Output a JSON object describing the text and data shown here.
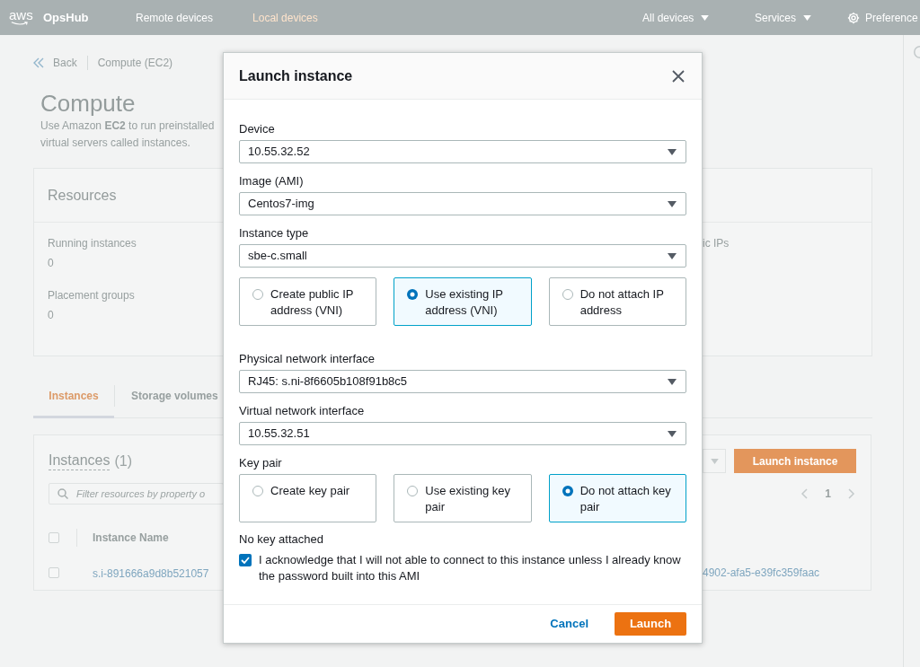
{
  "top_nav": {
    "logo": "aws",
    "app_name": "OpsHub",
    "tabs": [
      {
        "label": "Remote devices",
        "selected": false
      },
      {
        "label": "Local devices",
        "selected": true
      }
    ],
    "menus": [
      "All devices",
      "Services"
    ],
    "preferences": "Preference"
  },
  "breadcrumb": {
    "back": "Back",
    "current": "Compute (EC2)"
  },
  "page": {
    "title": "Compute",
    "description_lines": [
      "Use Amazon **EC2** to run preinstalled",
      "virtual servers called instances."
    ]
  },
  "resources": {
    "title": "Resources",
    "stats": [
      {
        "label": "Running instances",
        "value": "0"
      },
      {
        "label": "Placement groups",
        "value": "0"
      }
    ],
    "column_3": {
      "label": "ic IPs"
    }
  },
  "content_tabs": [
    {
      "label": "Instances",
      "selected": true
    },
    {
      "label": "Storage volumes",
      "selected": false
    }
  ],
  "instances": {
    "title": "Instances",
    "count": "(1)",
    "launch_button": "Launch instance",
    "search": {
      "placeholder": "Filter resources by property o"
    },
    "page": "1",
    "select_all": {
      "checked": false
    },
    "columns": [
      "Instance Name"
    ],
    "rows": [
      {
        "checked": false,
        "name": "s.i-891666a9d8b521057",
        "column_3": "4902-afa5-e39fc359faac"
      }
    ]
  },
  "modal": {
    "title": "Launch instance",
    "fields": [
      {
        "kind": "select",
        "label": "Device",
        "value": "10.55.32.52"
      },
      {
        "kind": "select",
        "label": "Image (AMI)",
        "value": "Centos7-img"
      },
      {
        "kind": "select",
        "label": "Instance type",
        "value": "sbe-c.small"
      },
      {
        "kind": "radio_cards",
        "options": [
          {
            "label": "Create public IP address (VNI)",
            "selected": false
          },
          {
            "label": "Use existing IP address (VNI)",
            "selected": true
          },
          {
            "label": "Do not attach IP address",
            "selected": false
          }
        ]
      },
      {
        "kind": "select",
        "label": "Physical network interface",
        "value": "RJ45: s.ni-8f6605b108f91b8c5"
      },
      {
        "kind": "select",
        "label": "Virtual network interface",
        "value": "10.55.32.51"
      },
      {
        "kind": "radio_cards",
        "label": "Key pair",
        "options": [
          {
            "label": "Create key pair",
            "selected": false
          },
          {
            "label": "Use existing key pair",
            "selected": false
          },
          {
            "label": "Do not attach key pair",
            "selected": true
          }
        ]
      }
    ],
    "note": "No key attached",
    "acknowledge": {
      "checked": true,
      "text": "I acknowledge that I will not able to connect to this instance unless I already know the password built into this AMI"
    },
    "buttons": [
      {
        "kind": "link",
        "label": "Cancel"
      },
      {
        "kind": "primary",
        "label": "Launch"
      }
    ]
  }
}
